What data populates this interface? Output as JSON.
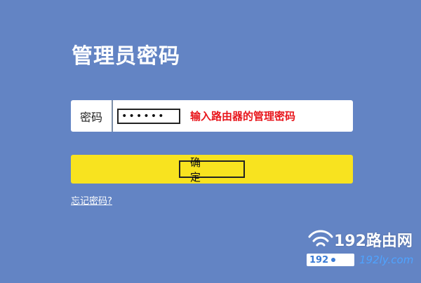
{
  "page": {
    "title": "管理员密码"
  },
  "form": {
    "password_label": "密码",
    "password_value": "••••••",
    "hint": "输入路由器的管理密码",
    "confirm_label": "确 定",
    "forgot_link": "忘记密码?"
  },
  "watermark": {
    "brand": "192路由网",
    "bar_number": "192",
    "domain": "192ly.com",
    "icon": "wifi-router-icon"
  },
  "colors": {
    "background": "#6384c4",
    "confirm_bar": "#f8e31f",
    "hint": "#e8161c"
  }
}
